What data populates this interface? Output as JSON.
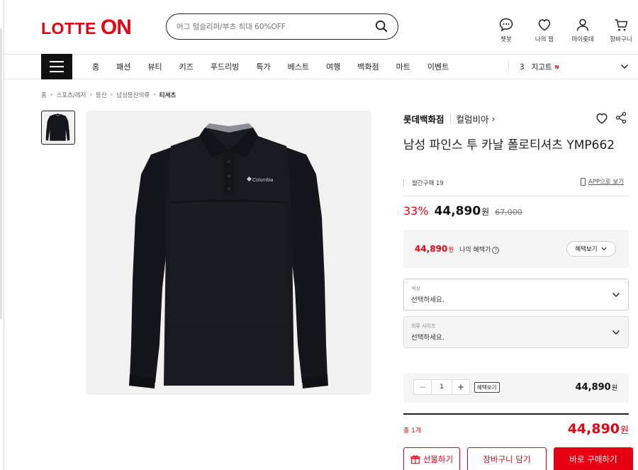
{
  "header": {
    "logo_main": "LOTTE",
    "logo_on": "ON",
    "search_placeholder": "어그 털슬리퍼/부츠 최대 60%OFF",
    "icons": [
      {
        "label": "챗봇",
        "icon": "chatbot-icon"
      },
      {
        "label": "나의 찜",
        "icon": "heart-icon"
      },
      {
        "label": "마이롯데",
        "icon": "user-icon"
      },
      {
        "label": "장바구니",
        "icon": "cart-icon"
      }
    ]
  },
  "nav": {
    "items": [
      "홈",
      "패션",
      "뷰티",
      "키즈",
      "푸드리빙",
      "특가",
      "베스트",
      "여행",
      "백화점",
      "마트",
      "이벤트"
    ],
    "trend_rank": "3",
    "trend_keyword": "지고트",
    "trend_badge": "N"
  },
  "breadcrumb": [
    "홈",
    "스포츠/레저",
    "등산",
    "남성등산의류",
    "티셔츠"
  ],
  "product": {
    "brand": "롯데백화점",
    "sub_brand": "컬럼비아",
    "sub_brand_arrow": "›",
    "title": "남성 파인스 투 카날 폴로티셔츠 YMP662",
    "monthly_sales": "월간구매 19",
    "app_link": "APP으로 보기",
    "discount": "33%",
    "price": "44,890",
    "price_unit": "원",
    "original_price": "67,000",
    "logo_text": "Columbia"
  },
  "benefit": {
    "price": "44,890",
    "won": "원",
    "label": "나의 혜택가",
    "info": "?",
    "button": "혜택보기"
  },
  "options": [
    {
      "label": "색상",
      "value": "선택하세요."
    },
    {
      "label": "의류 사이즈",
      "value": "선택하세요."
    }
  ],
  "quantity": {
    "minus": "−",
    "value": "1",
    "plus": "+",
    "benefit_tag": "혜택보기",
    "price": "44,890",
    "won": "원"
  },
  "total": {
    "label": "총 1개",
    "price": "44,890",
    "won": "원"
  },
  "buttons": {
    "gift": "선물하기",
    "cart": "장바구니 담기",
    "buy": "바로 구매하기"
  },
  "colors": {
    "brand_red": "#e60012",
    "text_dark": "#222222",
    "panel_grey": "#f5f5f5"
  }
}
